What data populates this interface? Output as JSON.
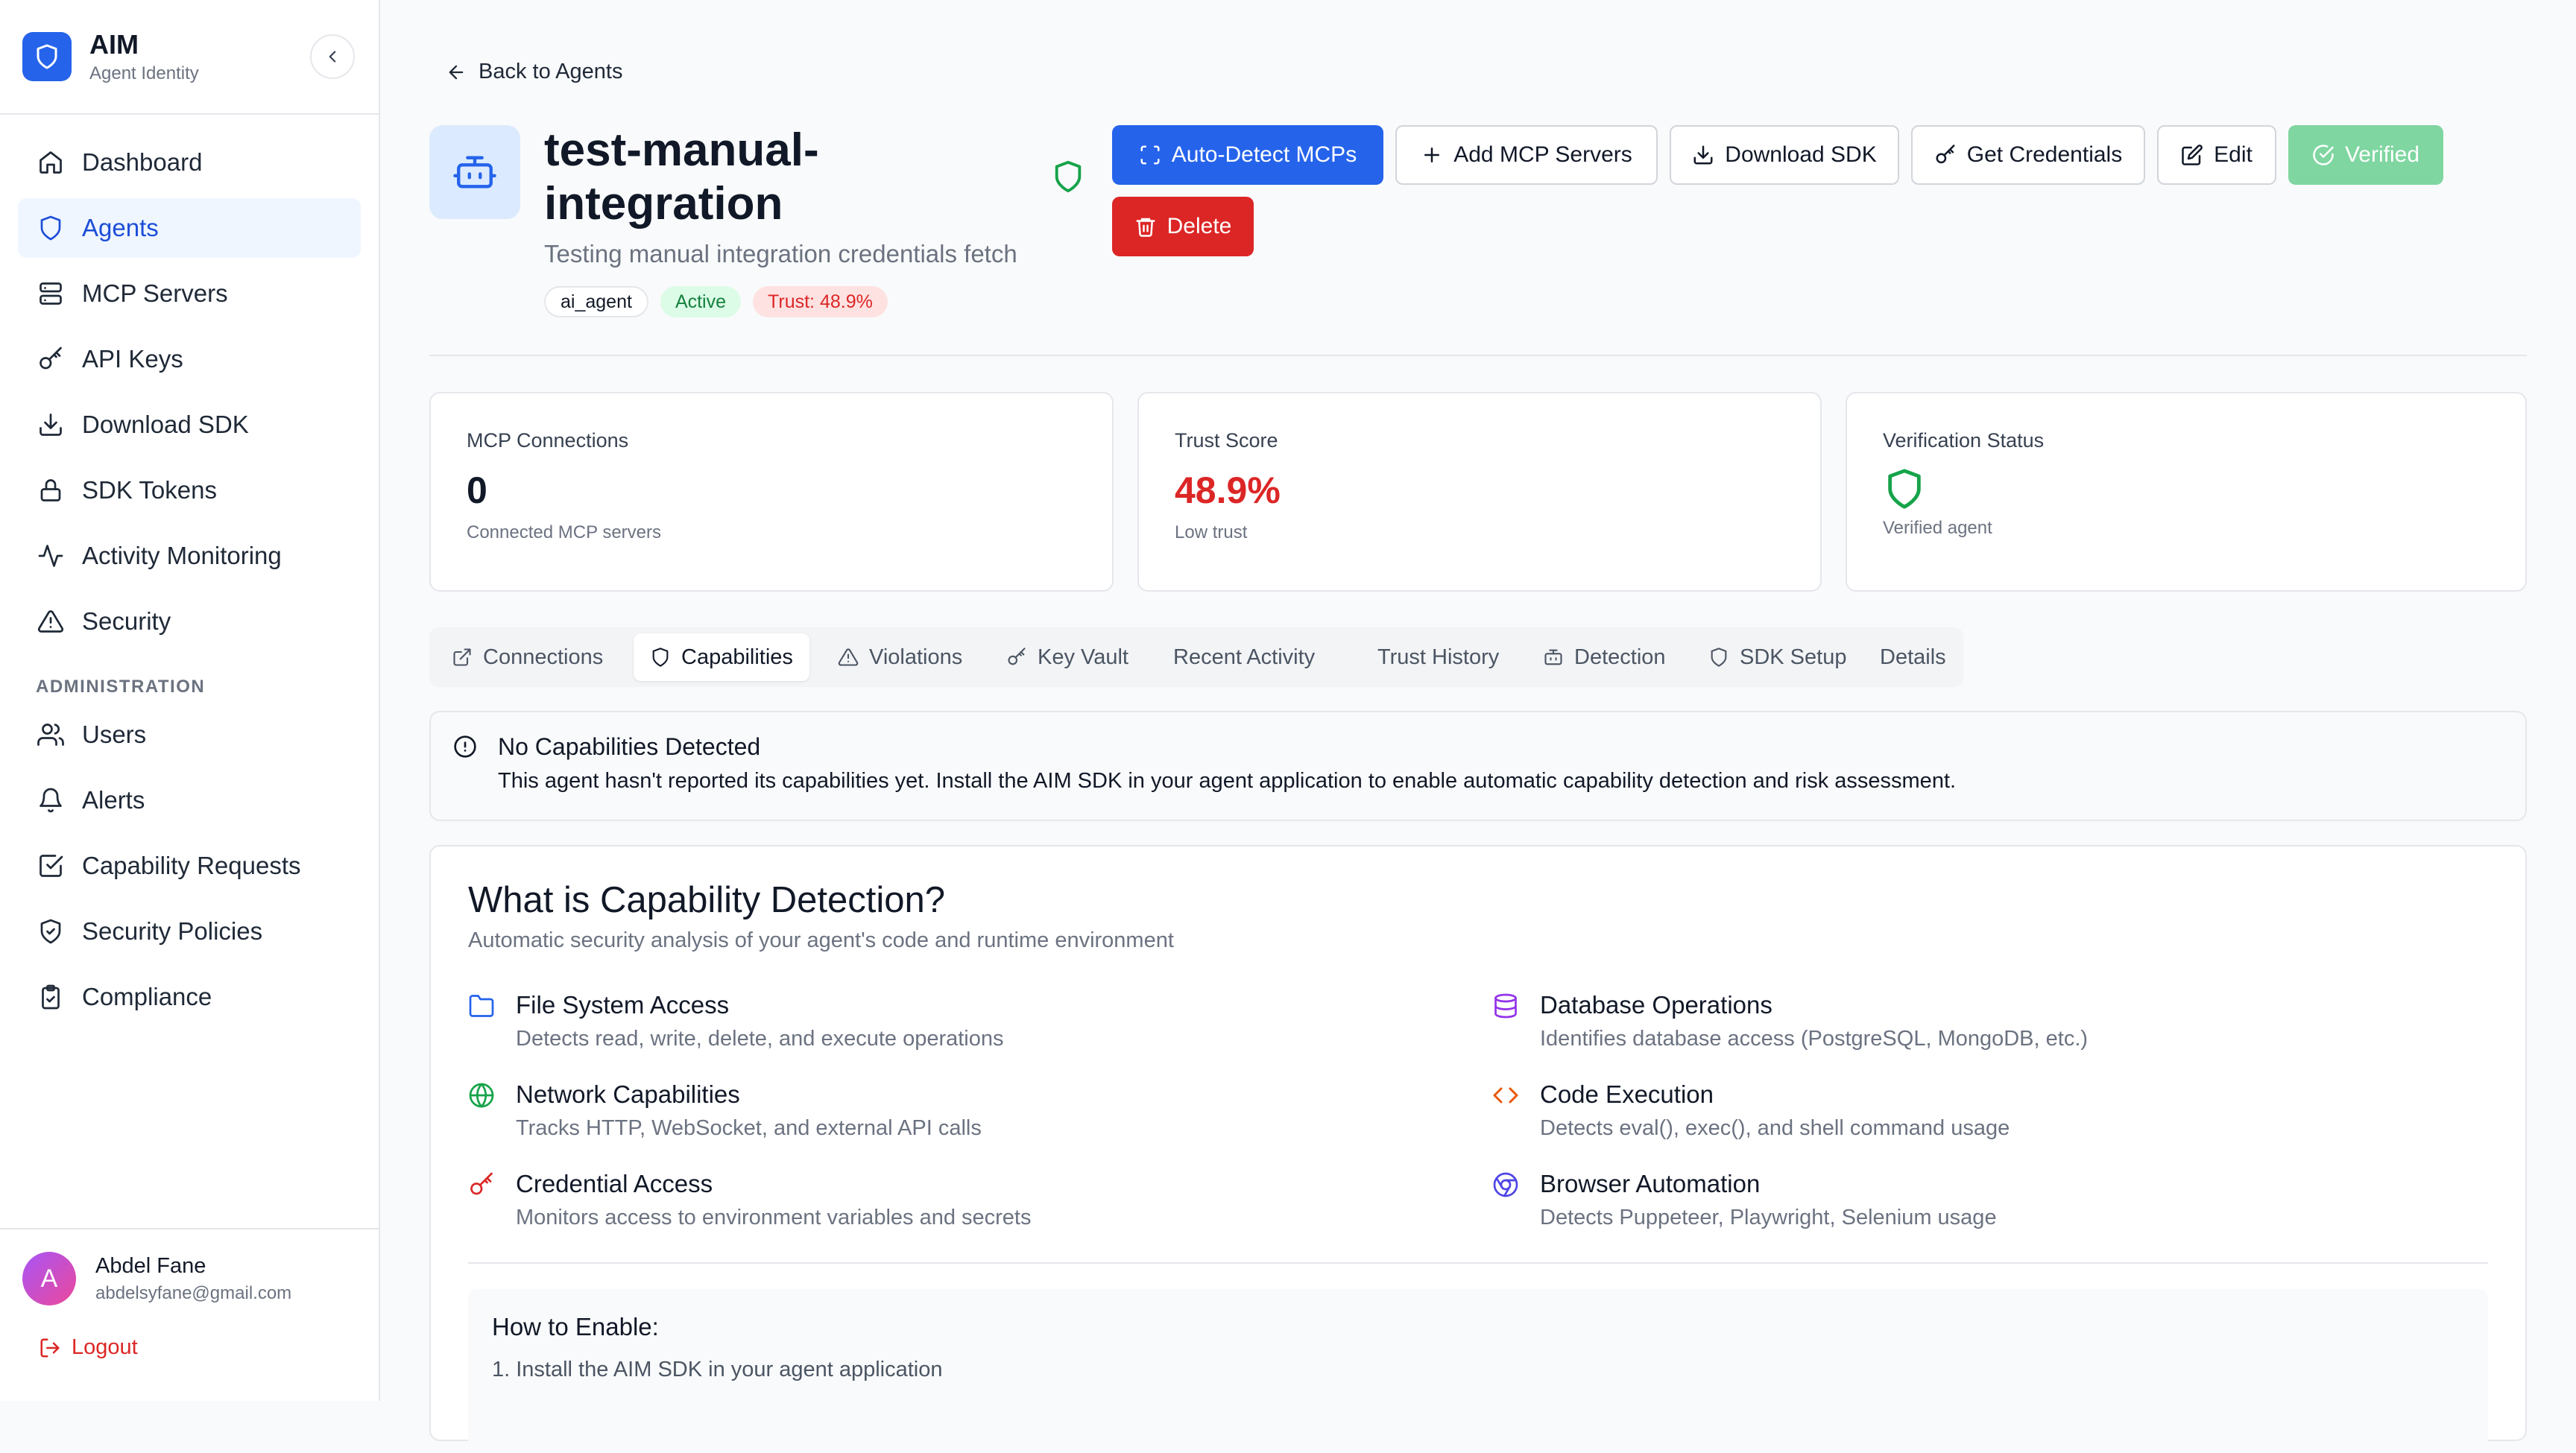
{
  "sidebar": {
    "brand_name": "AIM",
    "brand_sub": "Agent Identity",
    "nav": [
      {
        "label": "Dashboard",
        "icon": "home-icon"
      },
      {
        "label": "Agents",
        "icon": "shield-icon",
        "active": true
      },
      {
        "label": "MCP Servers",
        "icon": "server-icon"
      },
      {
        "label": "API Keys",
        "icon": "key-icon"
      },
      {
        "label": "Download SDK",
        "icon": "download-icon"
      },
      {
        "label": "SDK Tokens",
        "icon": "lock-icon"
      },
      {
        "label": "Activity Monitoring",
        "icon": "activity-icon"
      },
      {
        "label": "Security",
        "icon": "warning-icon"
      }
    ],
    "admin_section": "ADMINISTRATION",
    "admin_nav": [
      {
        "label": "Users",
        "icon": "users-icon"
      },
      {
        "label": "Alerts",
        "icon": "bell-icon"
      },
      {
        "label": "Capability Requests",
        "icon": "checkbox-icon"
      },
      {
        "label": "Security Policies",
        "icon": "shield-check-icon"
      },
      {
        "label": "Compliance",
        "icon": "clipboard-icon"
      }
    ],
    "user": {
      "initial": "A",
      "name": "Abdel Fane",
      "email": "abdelsyfane@gmail.com"
    },
    "logout": "Logout"
  },
  "header": {
    "back": "Back to Agents",
    "title": "test-manual-integration",
    "description": "Testing manual integration credentials fetch",
    "badges": [
      "ai_agent",
      "Active",
      "Trust: 48.9%"
    ]
  },
  "actions": {
    "auto_detect": "Auto-Detect MCPs",
    "add_mcp": "Add MCP Servers",
    "download_sdk": "Download SDK",
    "get_credentials": "Get Credentials",
    "edit": "Edit",
    "verified": "Verified",
    "delete": "Delete"
  },
  "stats": {
    "mcp": {
      "label": "MCP Connections",
      "value": "0",
      "sub": "Connected MCP servers"
    },
    "trust": {
      "label": "Trust Score",
      "value": "48.9%",
      "sub": "Low trust"
    },
    "verification": {
      "label": "Verification Status",
      "sub": "Verified agent"
    }
  },
  "tabs": [
    "Connections",
    "Capabilities",
    "Violations",
    "Key Vault",
    "Recent Activity",
    "Trust History",
    "Detection",
    "SDK Setup",
    "Details"
  ],
  "alert": {
    "title": "No Capabilities Detected",
    "body": "This agent hasn't reported its capabilities yet. Install the AIM SDK in your agent application to enable automatic capability detection and risk assessment."
  },
  "card": {
    "title": "What is Capability Detection?",
    "subtitle": "Automatic security analysis of your agent's code and runtime environment",
    "features": [
      {
        "title": "File System Access",
        "desc": "Detects read, write, delete, and execute operations"
      },
      {
        "title": "Database Operations",
        "desc": "Identifies database access (PostgreSQL, MongoDB, etc.)"
      },
      {
        "title": "Network Capabilities",
        "desc": "Tracks HTTP, WebSocket, and external API calls"
      },
      {
        "title": "Code Execution",
        "desc": "Detects eval(), exec(), and shell command usage"
      },
      {
        "title": "Credential Access",
        "desc": "Monitors access to environment variables and secrets"
      },
      {
        "title": "Browser Automation",
        "desc": "Detects Puppeteer, Playwright, Selenium usage"
      }
    ],
    "howto_title": "How to Enable:",
    "howto_steps": [
      "1. Install the AIM SDK in your agent application"
    ]
  },
  "colors": {
    "primary": "#2563eb",
    "danger": "#dc2626",
    "success": "#16a34a",
    "verified": "#7fd6a0"
  }
}
